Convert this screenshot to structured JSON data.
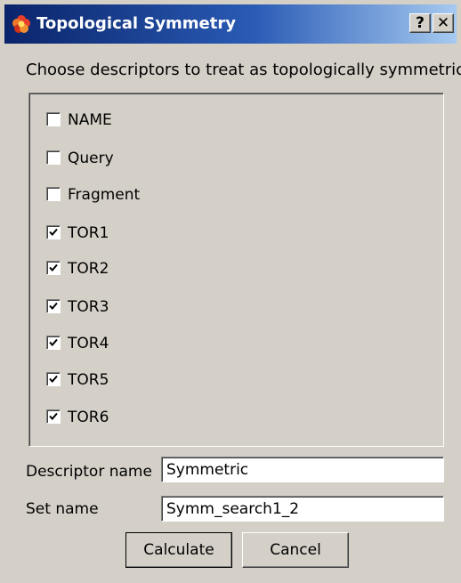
{
  "window": {
    "title": "Topological Symmetry",
    "help_label": "?",
    "close_label": "✕"
  },
  "prompt": "Choose descriptors to treat as topologically symmetric",
  "descriptors": [
    {
      "label": "NAME",
      "checked": false
    },
    {
      "label": "Query",
      "checked": false
    },
    {
      "label": "Fragment",
      "checked": false
    },
    {
      "label": "TOR1",
      "checked": true
    },
    {
      "label": "TOR2",
      "checked": true
    },
    {
      "label": "TOR3",
      "checked": true
    },
    {
      "label": "TOR4",
      "checked": true
    },
    {
      "label": "TOR5",
      "checked": true
    },
    {
      "label": "TOR6",
      "checked": true
    }
  ],
  "form": {
    "descriptor_name_label": "Descriptor name",
    "descriptor_name_value": "Symmetric",
    "set_name_label": "Set name",
    "set_name_value": "Symm_search1_2"
  },
  "buttons": {
    "calculate": "Calculate",
    "cancel": "Cancel"
  },
  "colors": {
    "titlebar_start": "#0a246a",
    "titlebar_end": "#a6caf0",
    "face": "#d4d0c8"
  },
  "icons": {
    "app": "ptc-flower-icon",
    "check": "check-icon"
  }
}
